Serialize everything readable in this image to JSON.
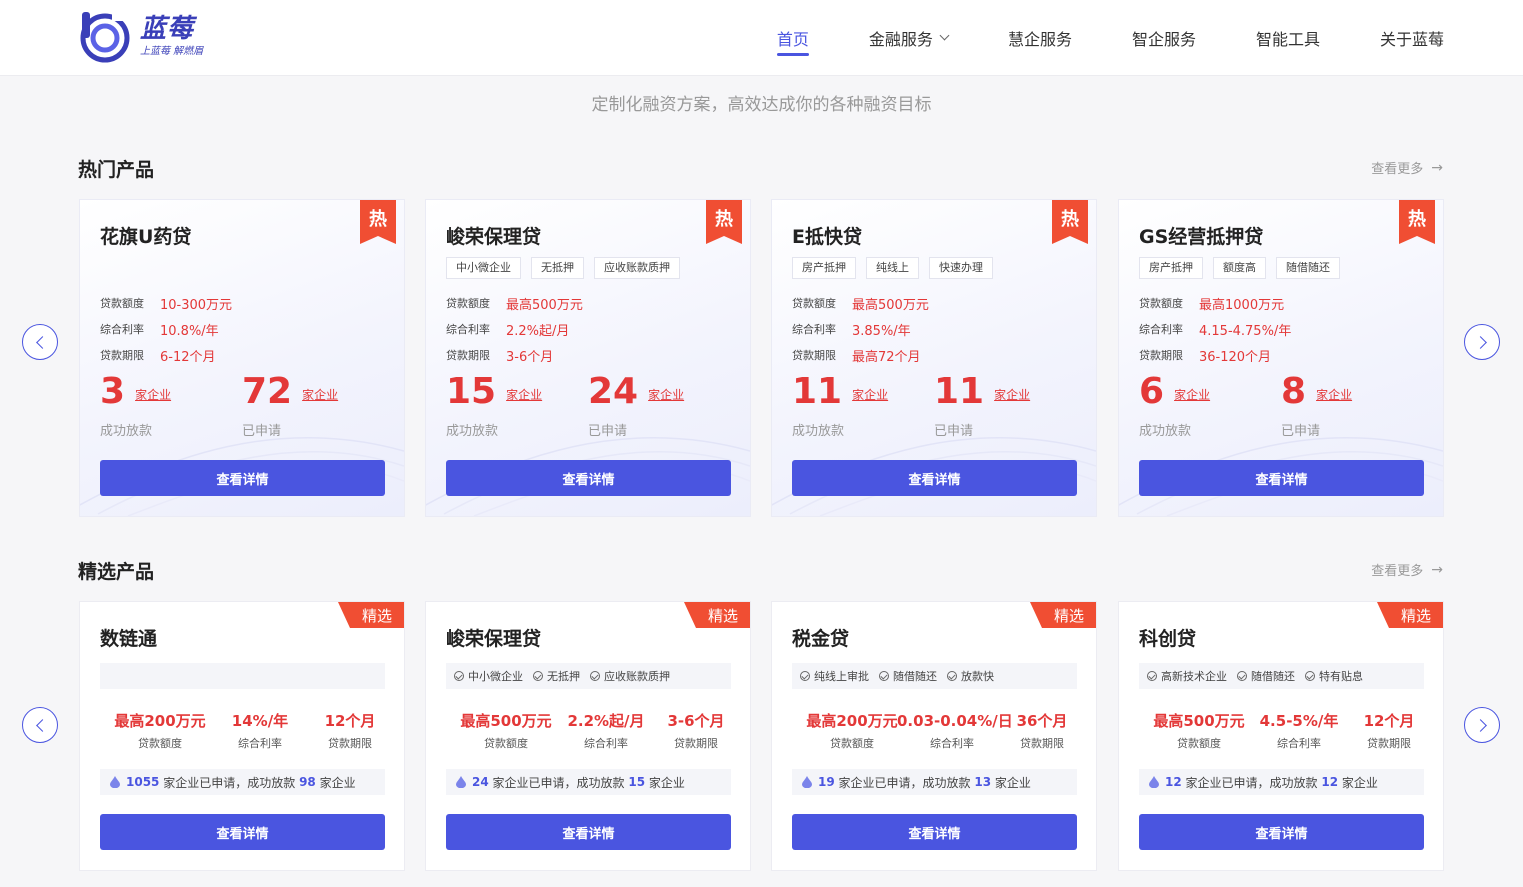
{
  "header": {
    "logo_name": "蓝莓",
    "logo_slogan": "上蓝莓 解燃眉",
    "nav": [
      {
        "label": "首页",
        "active": true
      },
      {
        "label": "金融服务",
        "dropdown": true
      },
      {
        "label": "慧企服务"
      },
      {
        "label": "智企服务"
      },
      {
        "label": "智能工具"
      },
      {
        "label": "关于蓝莓"
      }
    ]
  },
  "subtitle": "定制化融资方案，高效达成你的各种融资目标",
  "hot": {
    "title": "热门产品",
    "more": "查看更多",
    "badge": "热",
    "labels": {
      "amount": "贷款额度",
      "rate": "综合利率",
      "term": "贷款期限",
      "unit": "家企业",
      "success": "成功放款",
      "applied": "已申请"
    },
    "button": "查看详情",
    "cards": [
      {
        "name": "花旗U药贷",
        "tags": [],
        "amount": "10-300万元",
        "rate": "10.8%/年",
        "term": "6-12个月",
        "success": "3",
        "applied": "72"
      },
      {
        "name": "峻荣保理贷",
        "tags": [
          "中小微企业",
          "无抵押",
          "应收账款质押"
        ],
        "amount": "最高500万元",
        "rate": "2.2%起/月",
        "term": "3-6个月",
        "success": "15",
        "applied": "24"
      },
      {
        "name": "E抵快贷",
        "tags": [
          "房产抵押",
          "纯线上",
          "快速办理"
        ],
        "amount": "最高500万元",
        "rate": "3.85%/年",
        "term": "最高72个月",
        "success": "11",
        "applied": "11"
      },
      {
        "name": "GS经营抵押贷",
        "tags": [
          "房产抵押",
          "额度高",
          "随借随还"
        ],
        "amount": "最高1000万元",
        "rate": "4.15-4.75%/年",
        "term": "36-120个月",
        "success": "6",
        "applied": "8"
      }
    ]
  },
  "selected": {
    "title": "精选产品",
    "more": "查看更多",
    "badge": "精选",
    "labels": {
      "amount": "贷款额度",
      "rate": "综合利率",
      "term": "贷款期限",
      "apply_mid": "家企业已申请，成功放款",
      "apply_end": "家企业"
    },
    "button": "查看详情",
    "cards": [
      {
        "name": "数链通",
        "tags": [],
        "amount": "最高200万元",
        "rate": "14%/年",
        "term": "12个月",
        "applied": "1055",
        "success": "98"
      },
      {
        "name": "峻荣保理贷",
        "tags": [
          "中小微企业",
          "无抵押",
          "应收账款质押"
        ],
        "amount": "最高500万元",
        "rate": "2.2%起/月",
        "term": "3-6个月",
        "applied": "24",
        "success": "15"
      },
      {
        "name": "税金贷",
        "tags": [
          "纯线上审批",
          "随借随还",
          "放款快"
        ],
        "amount": "最高200万元",
        "rate": "0.03-0.04%/日",
        "term": "36个月",
        "applied": "19",
        "success": "13"
      },
      {
        "name": "科创贷",
        "tags": [
          "高新技术企业",
          "随借随还",
          "特有贴息"
        ],
        "amount": "最高500万元",
        "rate": "4.5-5%/年",
        "term": "12个月",
        "applied": "12",
        "success": "12"
      }
    ]
  },
  "colors": {
    "accent": "#4a55e0",
    "red": "#e33838"
  }
}
